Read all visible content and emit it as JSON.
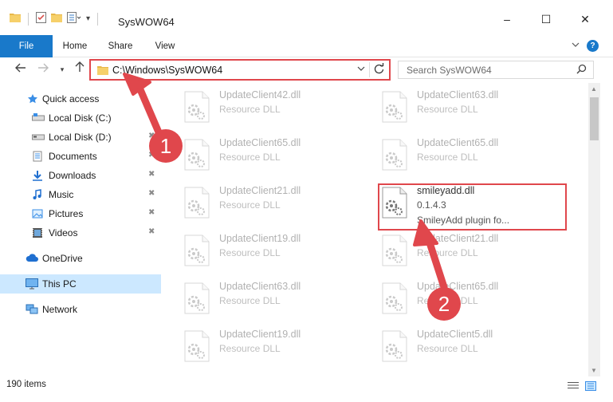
{
  "window": {
    "title": "SysWOW64",
    "controls": {
      "minimize": "–",
      "maximize": "☐",
      "close": "✕"
    }
  },
  "ribbon": {
    "tabs": [
      "File",
      "Home",
      "Share",
      "View"
    ],
    "help": "?",
    "collapse_icon": "chevron-down-icon"
  },
  "navigation": {
    "address": "C:\\Windows\\SysWOW64",
    "search_placeholder": "Search SysWOW64"
  },
  "sidebar": {
    "items": [
      {
        "label": "Quick access",
        "icon": "star-icon"
      },
      {
        "label": "Local Disk (C:)",
        "icon": "drive-icon"
      },
      {
        "label": "Local Disk (D:)",
        "icon": "drive-icon"
      },
      {
        "label": "Documents",
        "icon": "documents-icon"
      },
      {
        "label": "Downloads",
        "icon": "download-icon"
      },
      {
        "label": "Music",
        "icon": "music-icon"
      },
      {
        "label": "Pictures",
        "icon": "pictures-icon"
      },
      {
        "label": "Videos",
        "icon": "videos-icon"
      },
      {
        "label": "OneDrive",
        "icon": "cloud-icon"
      },
      {
        "label": "This PC",
        "icon": "computer-icon",
        "selected": true
      },
      {
        "label": "Network",
        "icon": "network-icon"
      }
    ]
  },
  "files": {
    "left": [
      {
        "name": "UpdateClient42.dll",
        "type": "Resource DLL"
      },
      {
        "name": "UpdateClient65.dll",
        "type": "Resource DLL"
      },
      {
        "name": "UpdateClient21.dll",
        "type": "Resource DLL"
      },
      {
        "name": "UpdateClient19.dll",
        "type": "Resource DLL"
      },
      {
        "name": "UpdateClient63.dll",
        "type": "Resource DLL"
      },
      {
        "name": "UpdateClient19.dll",
        "type": "Resource DLL"
      }
    ],
    "right": [
      {
        "name": "UpdateClient63.dll",
        "type": "Resource DLL"
      },
      {
        "name": "UpdateClient65.dll",
        "type": "Resource DLL"
      },
      {
        "name": "smileyadd.dll",
        "type": "0.1.4.3",
        "desc": "SmileyAdd plugin fo..."
      },
      {
        "name": "UpdateClient21.dll",
        "type": "Resource DLL"
      },
      {
        "name": "UpdateClient65.dll",
        "type": "Resource DLL"
      },
      {
        "name": "UpdateClient5.dll",
        "type": "Resource DLL"
      }
    ]
  },
  "status": {
    "item_count": "190 items"
  },
  "annotations": {
    "badge1": "1",
    "badge2": "2",
    "color": "#e0474c"
  },
  "colors": {
    "accent": "#1979ca",
    "selection": "#cce8ff",
    "highlight": "#e0474c"
  }
}
